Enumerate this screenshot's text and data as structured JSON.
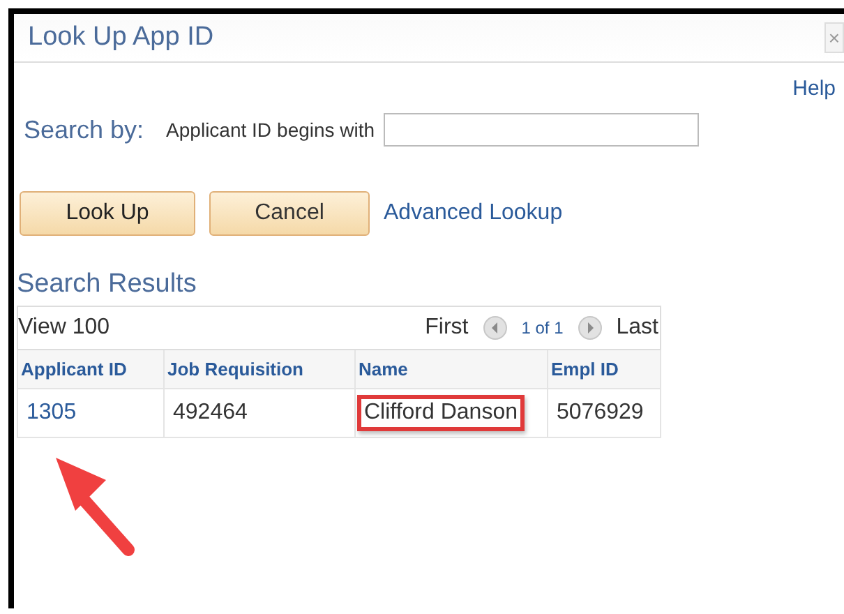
{
  "window": {
    "title": "Look Up App ID",
    "close": "×"
  },
  "help": "Help",
  "search": {
    "label": "Search by:",
    "field": "Applicant ID",
    "operator": "begins with"
  },
  "buttons": [
    "Look Up",
    "Cancel"
  ],
  "advanced_link": "Advanced Lookup",
  "results": {
    "title": "Search Results",
    "view": "View 100",
    "first": "First",
    "page": "1 of 1",
    "last": "Last",
    "columns": [
      "Applicant ID",
      "Job Requisition",
      "Name",
      "Empl ID"
    ],
    "rows": [
      [
        {
          "text": "1305",
          "kind": "link",
          "highlighted": false
        },
        {
          "text": "492464",
          "kind": "text",
          "highlighted": false
        },
        {
          "text": "Clifford Danson",
          "kind": "text",
          "highlighted": true
        },
        {
          "text": "5076929",
          "kind": "text",
          "highlighted": false
        }
      ]
    ]
  }
}
